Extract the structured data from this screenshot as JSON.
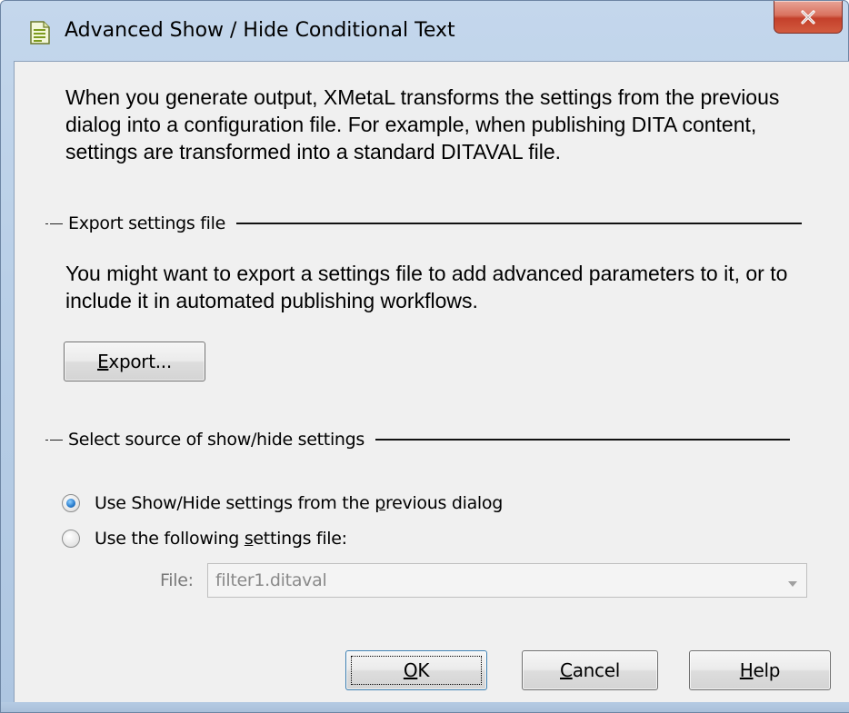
{
  "window": {
    "title": "Advanced Show / Hide Conditional Text",
    "close_glyph": "X"
  },
  "intro_text": "When you generate output, XMetaL transforms the settings from the previous dialog into a configuration file. For example, when publishing DITA content, settings are transformed into a standard DITAVAL file.",
  "export_group": {
    "label": "Export settings file",
    "description": "You might want to export a settings file to add advanced parameters to it, or to include it in automated publishing workflows.",
    "button": {
      "mnemonic": "E",
      "rest": "xport..."
    }
  },
  "source_group": {
    "label": "Select source of show/hide settings",
    "option1": {
      "before": "Use Show/Hide settings from the ",
      "mnemonic": "p",
      "after": "revious dialog",
      "checked": true
    },
    "option2": {
      "before": "Use the following ",
      "mnemonic": "s",
      "after": "ettings file:",
      "checked": false
    },
    "file_label": "File:",
    "file_value": "filter1.ditaval"
  },
  "buttons": {
    "ok": {
      "mnemonic": "O",
      "rest": "K"
    },
    "cancel": {
      "mnemonic": "C",
      "rest": "ancel"
    },
    "help": {
      "mnemonic": "H",
      "rest": "elp"
    }
  },
  "icons": {
    "title_icon": "document-icon",
    "close_icon": "close-icon",
    "combo_arrow": "chevron-down-icon"
  },
  "colors": {
    "frame": "#b9cfe7",
    "client_bg": "#f0f0f0",
    "close_red": "#c4402b",
    "radio_blue": "#2c7fcf"
  }
}
